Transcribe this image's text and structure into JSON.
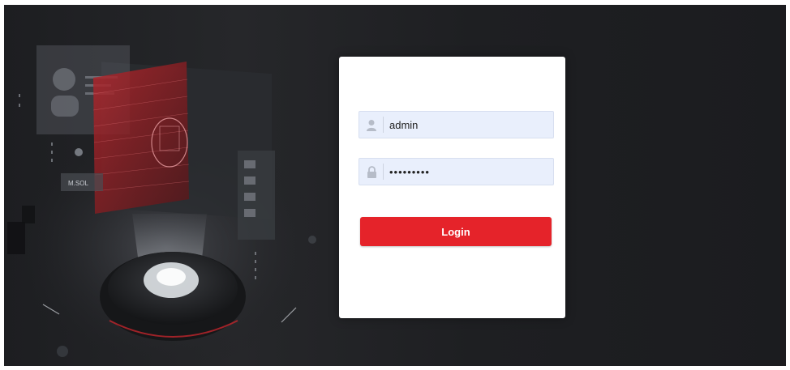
{
  "login": {
    "username": {
      "value": "admin",
      "icon": "user-icon"
    },
    "password": {
      "value": "•••••••••",
      "icon": "lock-icon"
    },
    "button_label": "Login"
  },
  "hero": {
    "panel_text": "M.SOL"
  },
  "colors": {
    "background": "#1e1f22",
    "card": "#ffffff",
    "field_bg": "#e9effc",
    "accent": "#e5232a"
  }
}
